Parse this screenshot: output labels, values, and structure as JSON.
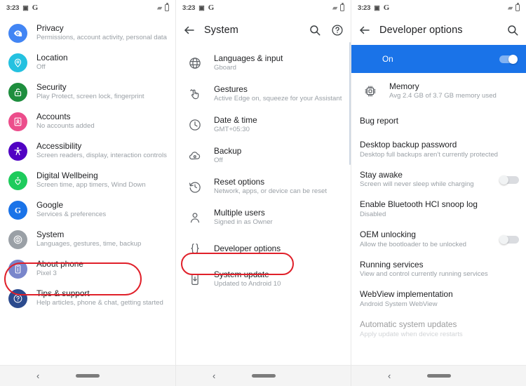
{
  "statusbar": {
    "time": "3:23",
    "icons": [
      "screenshot-icon",
      "google-icon",
      "wifi-icon",
      "battery-icon"
    ]
  },
  "colors": {
    "accent_blue": "#1a73e8",
    "highlight_red": "#e0202a",
    "title_text": "#202124",
    "subtitle_text": "#9aa0a6"
  },
  "screen1": {
    "name": "Settings",
    "items": [
      {
        "icon": "privacy-icon",
        "color": "#4285f4",
        "title": "Privacy",
        "subtitle": "Permissions, account activity, personal data"
      },
      {
        "icon": "location-pin-icon",
        "color": "#24c1e0",
        "title": "Location",
        "subtitle": "Off"
      },
      {
        "icon": "security-lock-icon",
        "color": "#1e8e3e",
        "title": "Security",
        "subtitle": "Play Protect, screen lock, fingerprint"
      },
      {
        "icon": "accounts-icon",
        "color": "#ec4d8b",
        "title": "Accounts",
        "subtitle": "No accounts added"
      },
      {
        "icon": "accessibility-icon",
        "color": "#5102c3",
        "title": "Accessibility",
        "subtitle": "Screen readers, display, interaction controls"
      },
      {
        "icon": "wellbeing-heart-icon",
        "color": "#1ecb5c",
        "title": "Digital Wellbeing",
        "subtitle": "Screen time, app timers, Wind Down"
      },
      {
        "icon": "google-g-icon",
        "color": "#1a73e8",
        "title": "Google",
        "subtitle": "Services & preferences"
      },
      {
        "icon": "system-info-icon",
        "color": "#9aa0a6",
        "title": "System",
        "subtitle": "Languages, gestures, time, backup",
        "highlighted": true
      },
      {
        "icon": "phone-icon",
        "color": "#7986cb",
        "title": "About phone",
        "subtitle": "Pixel 3"
      },
      {
        "icon": "help-icon",
        "color": "#2c4b8e",
        "title": "Tips & support",
        "subtitle": "Help articles, phone & chat, getting started"
      }
    ]
  },
  "screen2": {
    "title": "System",
    "back_label": "back-arrow",
    "actions": [
      "search-icon",
      "help-icon"
    ],
    "items": [
      {
        "icon": "globe-icon",
        "title": "Languages & input",
        "subtitle": "Gboard"
      },
      {
        "icon": "gestures-icon",
        "title": "Gestures",
        "subtitle": "Active Edge on, squeeze for your Assistant"
      },
      {
        "icon": "clock-icon",
        "title": "Date & time",
        "subtitle": "GMT+05:30"
      },
      {
        "icon": "cloud-backup-icon",
        "title": "Backup",
        "subtitle": "Off"
      },
      {
        "icon": "history-reset-icon",
        "title": "Reset options",
        "subtitle": "Network, apps, or device can be reset"
      },
      {
        "icon": "person-icon",
        "title": "Multiple users",
        "subtitle": "Signed in as Owner"
      },
      {
        "icon": "braces-icon",
        "title": "Developer options",
        "subtitle": "",
        "highlighted": true
      },
      {
        "icon": "system-update-icon",
        "title": "System update",
        "subtitle": "Updated to Android 10"
      }
    ]
  },
  "screen3": {
    "title": "Developer options",
    "back_label": "back-arrow",
    "actions": [
      "search-icon"
    ],
    "banner": {
      "label": "On",
      "toggle": "on",
      "bg": "#1a73e8"
    },
    "items": [
      {
        "icon": "memory-chip-icon",
        "title": "Memory",
        "subtitle": "Avg 2.4 GB of 3.7 GB memory used"
      },
      {
        "icon": "",
        "title": "Bug report",
        "subtitle": ""
      },
      {
        "icon": "",
        "title": "Desktop backup password",
        "subtitle": "Desktop full backups aren't currently protected"
      },
      {
        "icon": "",
        "title": "Stay awake",
        "subtitle": "Screen will never sleep while charging",
        "toggle": "off"
      },
      {
        "icon": "",
        "title": "Enable Bluetooth HCI snoop log",
        "subtitle": "Disabled"
      },
      {
        "icon": "",
        "title": "OEM unlocking",
        "subtitle": "Allow the bootloader to be unlocked",
        "toggle": "off"
      },
      {
        "icon": "",
        "title": "Running services",
        "subtitle": "View and control currently running services"
      },
      {
        "icon": "",
        "title": "WebView implementation",
        "subtitle": "Android System WebView"
      },
      {
        "icon": "",
        "title": "Automatic system updates",
        "subtitle": "Apply update when device restarts",
        "cut_off": true
      }
    ]
  },
  "navbar": {
    "back": "‹",
    "pill": "home-pill"
  }
}
